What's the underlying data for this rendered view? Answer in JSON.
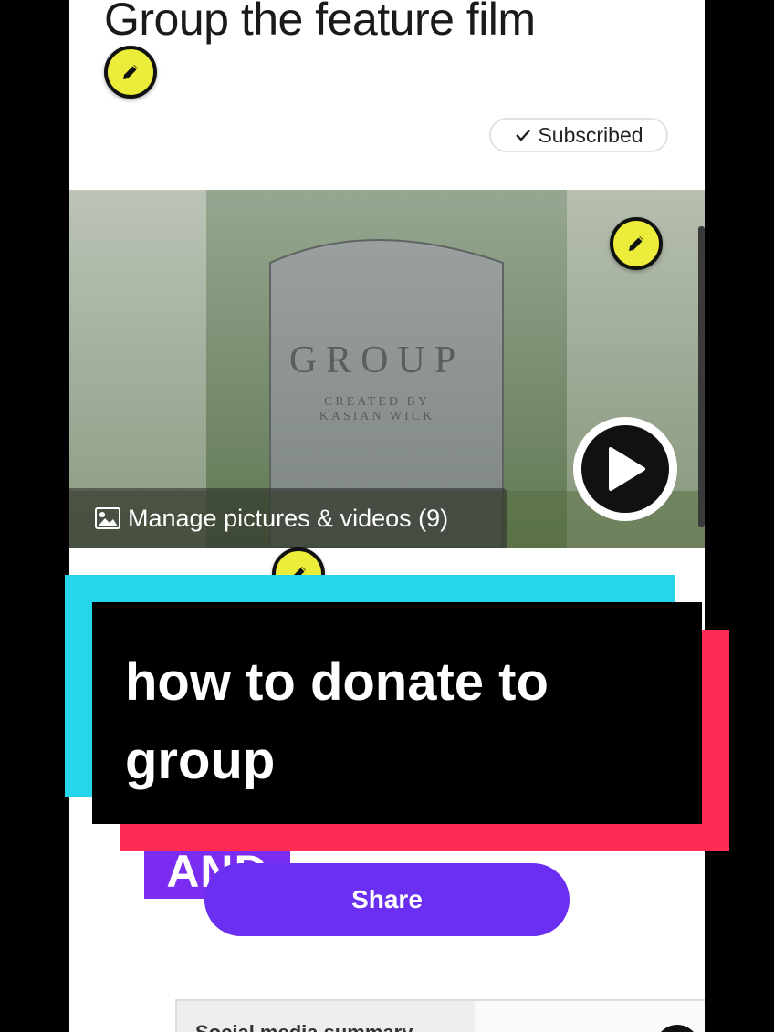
{
  "header": {
    "title": "Group the feature film"
  },
  "subscription": {
    "label": "Subscribed"
  },
  "media": {
    "poster_title": "GROUP",
    "poster_credit_line1": "CREATED BY",
    "poster_credit_line2": "KASIAN WICK",
    "manage_label": "Manage pictures & videos (9)"
  },
  "overlay": {
    "caption": "how to donate to group"
  },
  "badge": {
    "label": "AND"
  },
  "actions": {
    "share_label": "Share"
  },
  "social": {
    "summary_label": "Social media summary"
  },
  "colors": {
    "pencil_yellow": "#ecec3a",
    "share_purple": "#6a2ff0",
    "accent_cyan": "#25d6eb",
    "accent_red": "#fe2c55"
  }
}
